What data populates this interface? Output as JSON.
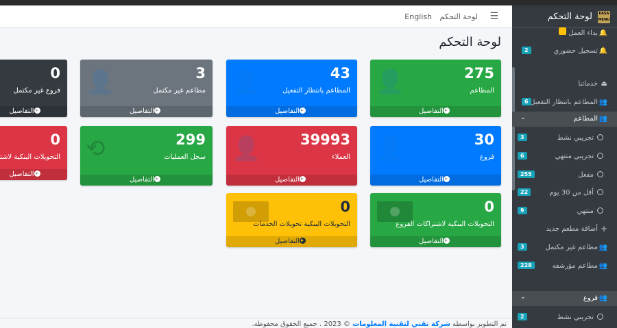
{
  "navbar": {
    "toggle_icon": "menu-icon",
    "dashboard_link": "لوحة التحكم",
    "language_link": "English"
  },
  "page": {
    "title": "لوحة التحكم"
  },
  "details_label": "التفاصيل",
  "cards": [
    {
      "value": "275",
      "label": "المطاعم",
      "color": "#28a745",
      "icon": "user-plus-icon"
    },
    {
      "value": "43",
      "label": "المطاعم بانتظار التفعيل",
      "color": "#007bff",
      "icon": "user-plus-icon"
    },
    {
      "value": "3",
      "label": "مطاعم غير مكتمل",
      "color": "#6c757d",
      "icon": "user-plus-icon"
    },
    {
      "value": "0",
      "label": "فروع غير مكتمل",
      "color": "#343a40",
      "icon": "user-plus-icon"
    },
    {
      "value": "30",
      "label": "فروع",
      "color": "#007bff",
      "icon": "user-plus-icon"
    },
    {
      "value": "39993",
      "label": "العملاء",
      "color": "#dc3545",
      "icon": "user-plus-icon"
    },
    {
      "value": "299",
      "label": "سجل العمليات",
      "color": "#28a745",
      "icon": "history-icon"
    },
    {
      "value": "0",
      "label": "التحويلات البنكية لاشتراكات الفروع",
      "color": "#dc3545",
      "icon": "money-icon"
    },
    {
      "value": "0",
      "label": "التحويلات البنكية لاشتراكات الفروع",
      "color": "#28a745",
      "icon": "money-icon"
    },
    {
      "value": "0",
      "label": "التحويلات البنكية تحويلات الخدمات",
      "color": "#ffc107",
      "icon": "money-icon"
    }
  ],
  "footer": {
    "prefix": "تم التطوير بواسطه",
    "company": "شركة تقني لتقنية المعلومات",
    "suffix": "© 2023 . جميع الحقوق محفوظه."
  },
  "sidebar": {
    "brand": "لوحة التحكم",
    "logo_text": "EASA MENU",
    "items": [
      {
        "label": "بداء العمل",
        "icon": "bell-icon"
      },
      {
        "label": "تسجيل حضوري",
        "icon": "bell-icon",
        "badge": "2"
      },
      {
        "label": "خدماتنا",
        "icon": "bell-outline-icon"
      },
      {
        "label": "المطاعم بانتظار التفعيل",
        "icon": "users-icon",
        "badge": "6"
      },
      {
        "label": "المطاعم",
        "icon": "users-icon"
      },
      {
        "label": "تجريبي نشط",
        "icon": "circle-icon",
        "badge": "3"
      },
      {
        "label": "تجريبي منتهي",
        "icon": "circle-icon",
        "badge": "6"
      },
      {
        "label": "مفعل",
        "icon": "circle-icon",
        "badge": "255"
      },
      {
        "label": "أقل من 30 يوم",
        "icon": "circle-icon",
        "badge": "22"
      },
      {
        "label": "منتهي",
        "icon": "circle-icon",
        "badge": "9"
      },
      {
        "label": "أضافة مطعم جديد",
        "icon": "plus-icon"
      },
      {
        "label": "مطاعم غير مكتمل",
        "icon": "users-icon",
        "badge": "3"
      },
      {
        "label": "مطاعم مؤرشفه",
        "icon": "users-icon",
        "badge": "228"
      },
      {
        "label": "فروع",
        "icon": "users-icon"
      },
      {
        "label": "تجريبي نشط",
        "icon": "circle-icon",
        "badge": "2"
      }
    ]
  }
}
